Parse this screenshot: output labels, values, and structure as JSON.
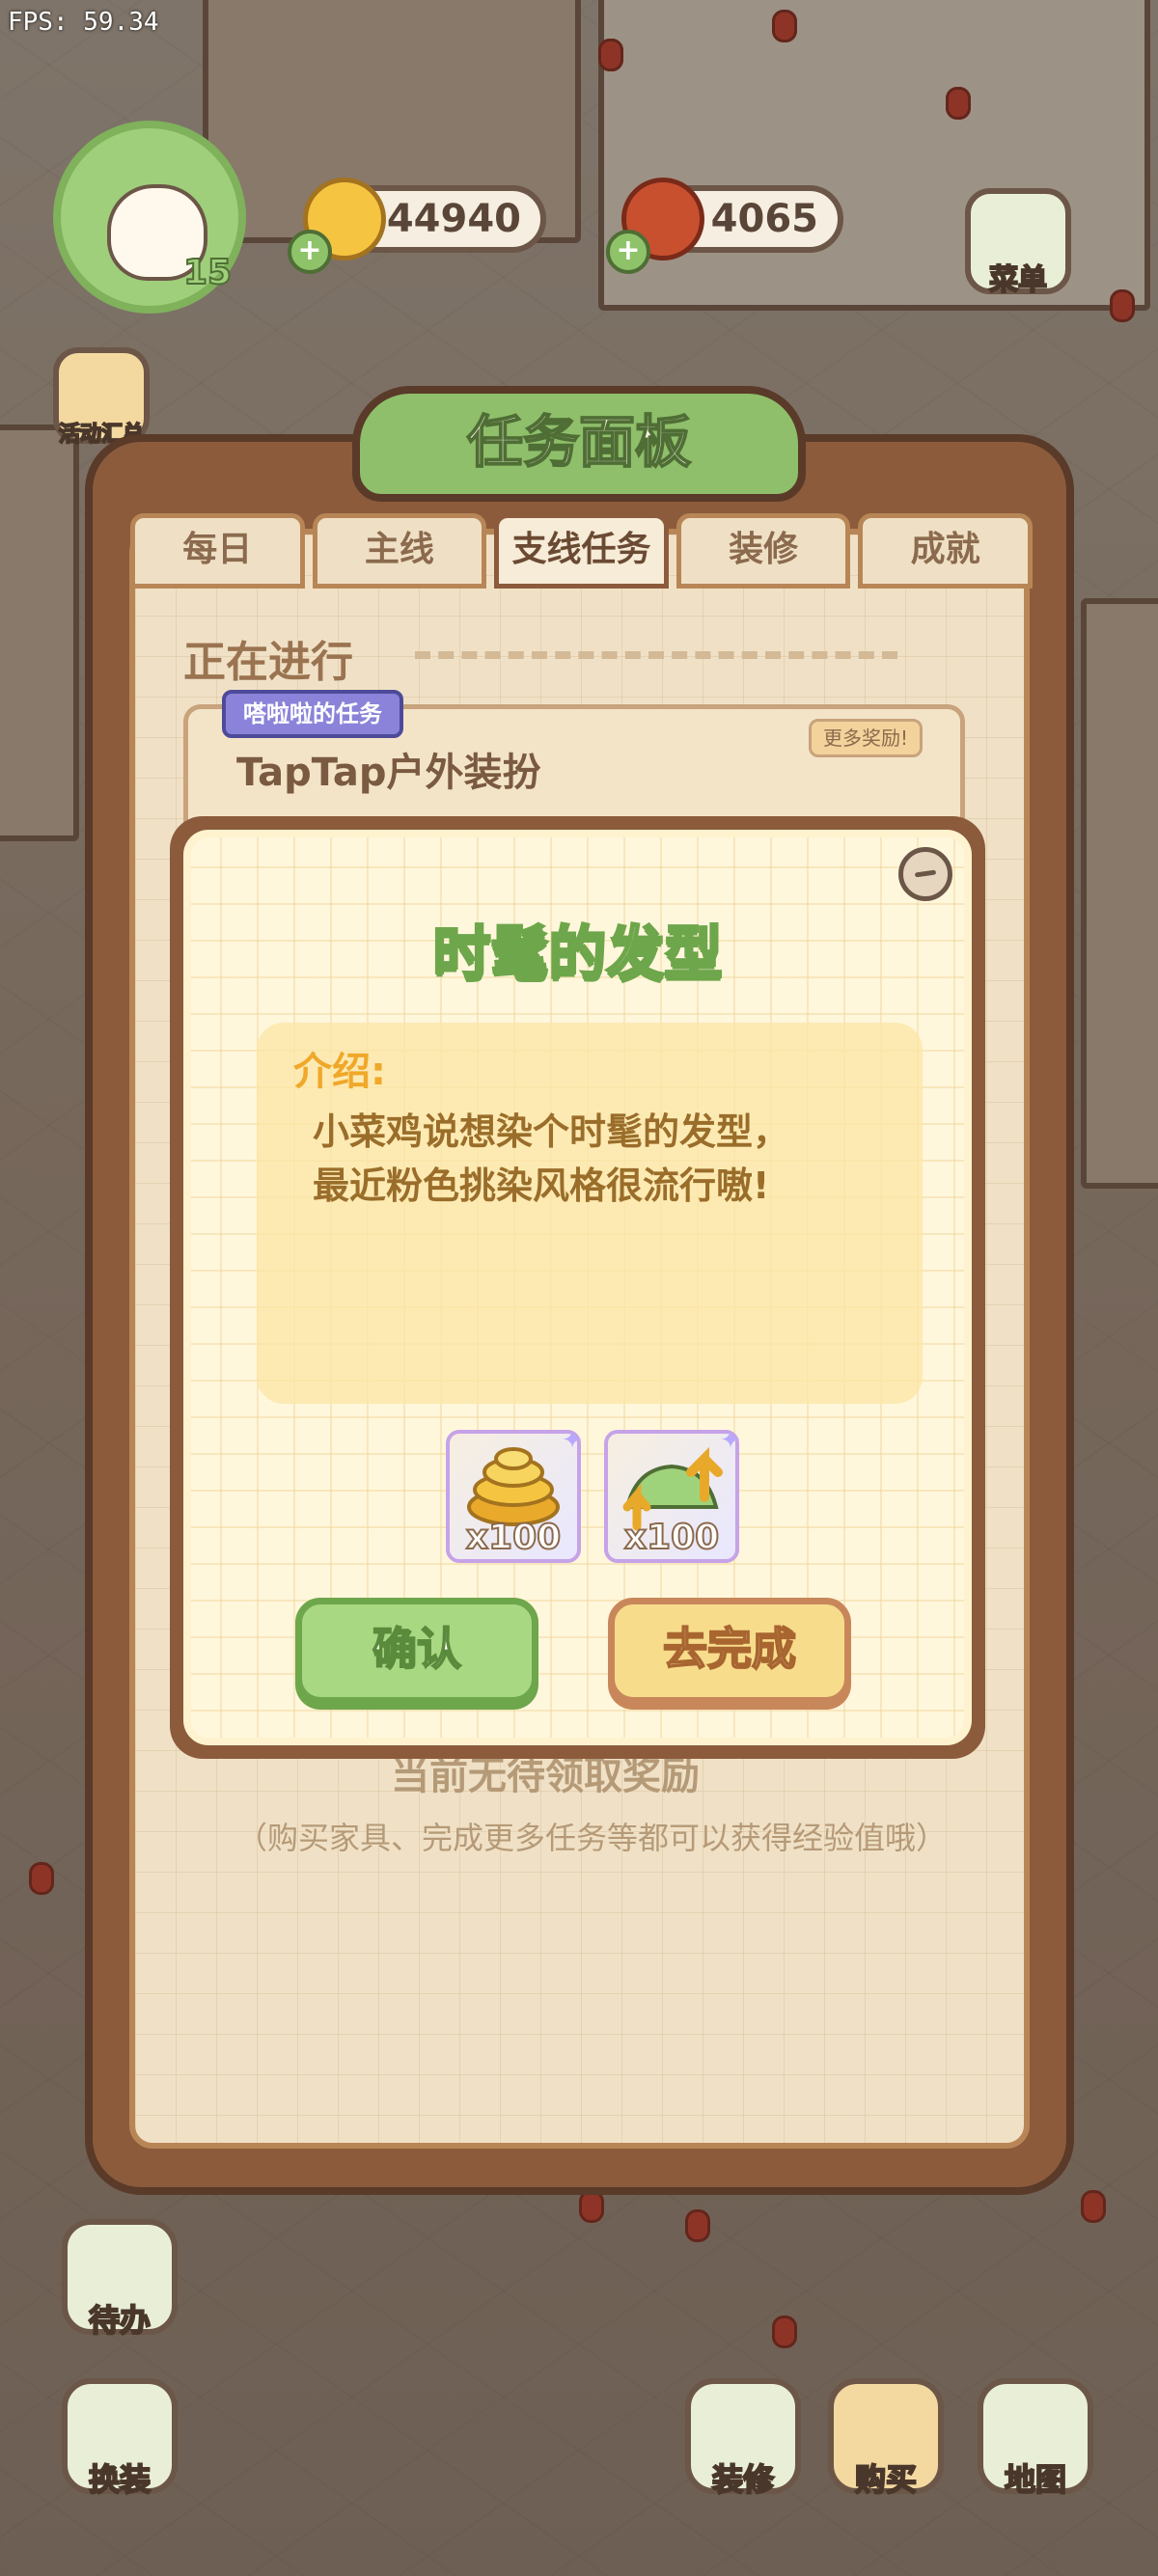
{
  "fps": "FPS: 59.34",
  "hud": {
    "level": "15",
    "coins": "44940",
    "meat": "4065",
    "menu_label": "菜单",
    "events_label": "活动汇总"
  },
  "board": {
    "title": "任务面板",
    "tabs": [
      "每日",
      "主线",
      "支线任务",
      "装修",
      "成就"
    ],
    "active_tab": "支线任务",
    "section": "正在进行",
    "task_tag": "嗒啦啦的任务",
    "task_name": "TapTap户外装扮",
    "more_reward": "更多奖励!",
    "no_reward": "当前无待领取奖励",
    "hint": "（购买家具、完成更多任务等都可以获得经验值哦）"
  },
  "dialog": {
    "title": "时髦的发型",
    "intro_label": "介绍:",
    "intro_text": "小菜鸡说想染个时髦的发型，\n最近粉色挑染风格很流行嗷!",
    "rewards": [
      {
        "icon": "gold-coins-icon",
        "qty": "x100"
      },
      {
        "icon": "exp-leaf-icon",
        "qty": "x100"
      }
    ],
    "confirm_label": "确认",
    "go_label": "去完成"
  },
  "bottom": {
    "todo": "待办",
    "dress": "换装",
    "decorate": "装修",
    "buy": "购买",
    "map": "地图"
  },
  "colors": {
    "board_brown": "#8b5b3c",
    "title_green": "#8fbf6b",
    "confirm_green": "#a8d882",
    "go_yellow": "#f7dc8c",
    "intro_orange": "#f0a82a"
  }
}
